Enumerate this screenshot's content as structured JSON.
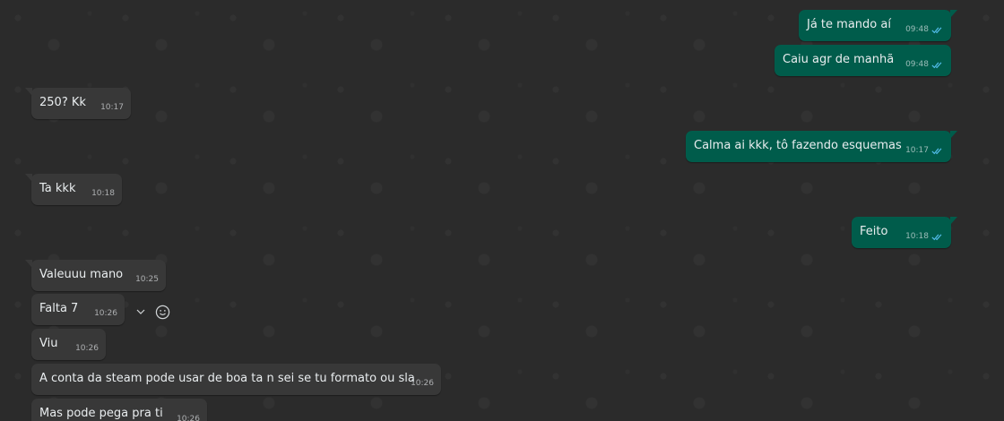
{
  "chat": {
    "messages": [
      {
        "dir": "out",
        "text": "Já te mando aí",
        "time": "09:48",
        "read": true
      },
      {
        "dir": "out",
        "text": "Caiu agr de manhã",
        "time": "09:48",
        "read": true
      },
      {
        "dir": "in",
        "text": "250? Kk",
        "time": "10:17"
      },
      {
        "dir": "out",
        "text": "Calma ai kkk, tô fazendo esquemas",
        "time": "10:17",
        "read": true
      },
      {
        "dir": "in",
        "text": "Ta kkk",
        "time": "10:18"
      },
      {
        "dir": "out",
        "text": "Feito",
        "time": "10:18",
        "read": true
      },
      {
        "dir": "in",
        "text": "Valeuuu mano",
        "time": "10:25"
      },
      {
        "dir": "in",
        "text": "Falta 7",
        "time": "10:26"
      },
      {
        "dir": "in",
        "text": "Viu",
        "time": "10:26"
      },
      {
        "dir": "in",
        "text": "A conta da steam pode usar de boa ta n sei se tu formato ou sla",
        "time": "10:26"
      },
      {
        "dir": "in",
        "text": "Mas pode pega pra ti",
        "time": "10:26"
      }
    ]
  },
  "icons": {
    "read_receipt": "double-check-icon",
    "menu": "chevron-down-icon",
    "react": "emoji-smile-icon"
  },
  "colors": {
    "background": "#2b2b2b",
    "incoming_bubble": "#383838",
    "outgoing_bubble": "#005c4b",
    "read_check": "#53bdeb"
  }
}
